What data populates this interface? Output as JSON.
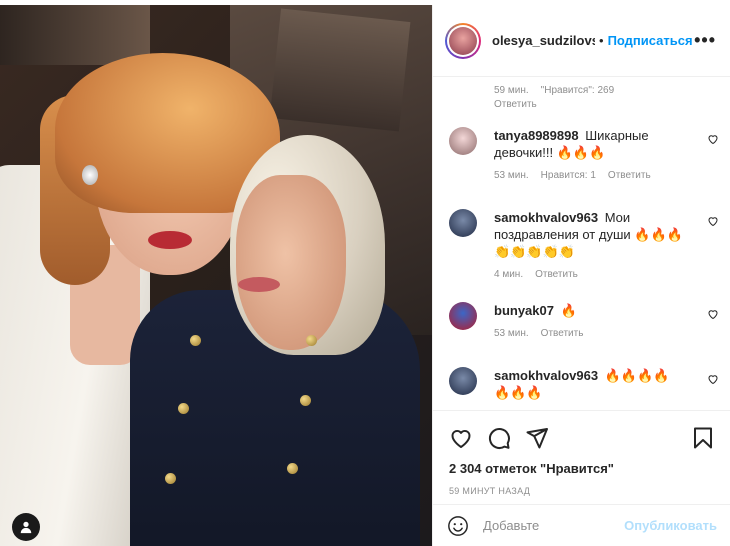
{
  "post": {
    "username": "olesya_sudzilovska",
    "follow_label": "Подписаться",
    "more_label": "•••",
    "separator": "•"
  },
  "top_meta": {
    "time": "59 мин.",
    "likes": "\"Нравится\": 269",
    "reply": "Ответить"
  },
  "comments": [
    {
      "user": "tanya8989898",
      "text": "Шикарные девочки!!!",
      "emoji": "🔥🔥🔥",
      "time": "53 мин.",
      "likes": "Нравится: 1",
      "reply": "Ответить"
    },
    {
      "user": "samokhvalov963",
      "text": "Мои поздравления от души",
      "emoji": "🔥🔥🔥👏👏👏👏👏",
      "time": "4 мин.",
      "likes": "",
      "reply": "Ответить"
    },
    {
      "user": "bunyak07",
      "text": "",
      "emoji": "🔥",
      "time": "53 мин.",
      "likes": "",
      "reply": "Ответить"
    },
    {
      "user": "samokhvalov963",
      "text": "",
      "emoji": "🔥🔥🔥🔥🔥🔥🔥",
      "time": "",
      "likes": "",
      "reply": ""
    }
  ],
  "likes_count": "2 304 отметок \"Нравится\"",
  "posted_time": "59 МИНУТ НАЗАД",
  "add_comment": {
    "placeholder": "Добавьте",
    "publish_label": "Опубликовать"
  },
  "icons": [
    "heart-icon",
    "comment-icon",
    "share-icon",
    "bookmark-icon",
    "smile-icon",
    "user-tag-icon"
  ],
  "colors": {
    "accent": "#0095f6",
    "publish_disabled": "#b2dffc",
    "muted": "#8e8e8e"
  }
}
